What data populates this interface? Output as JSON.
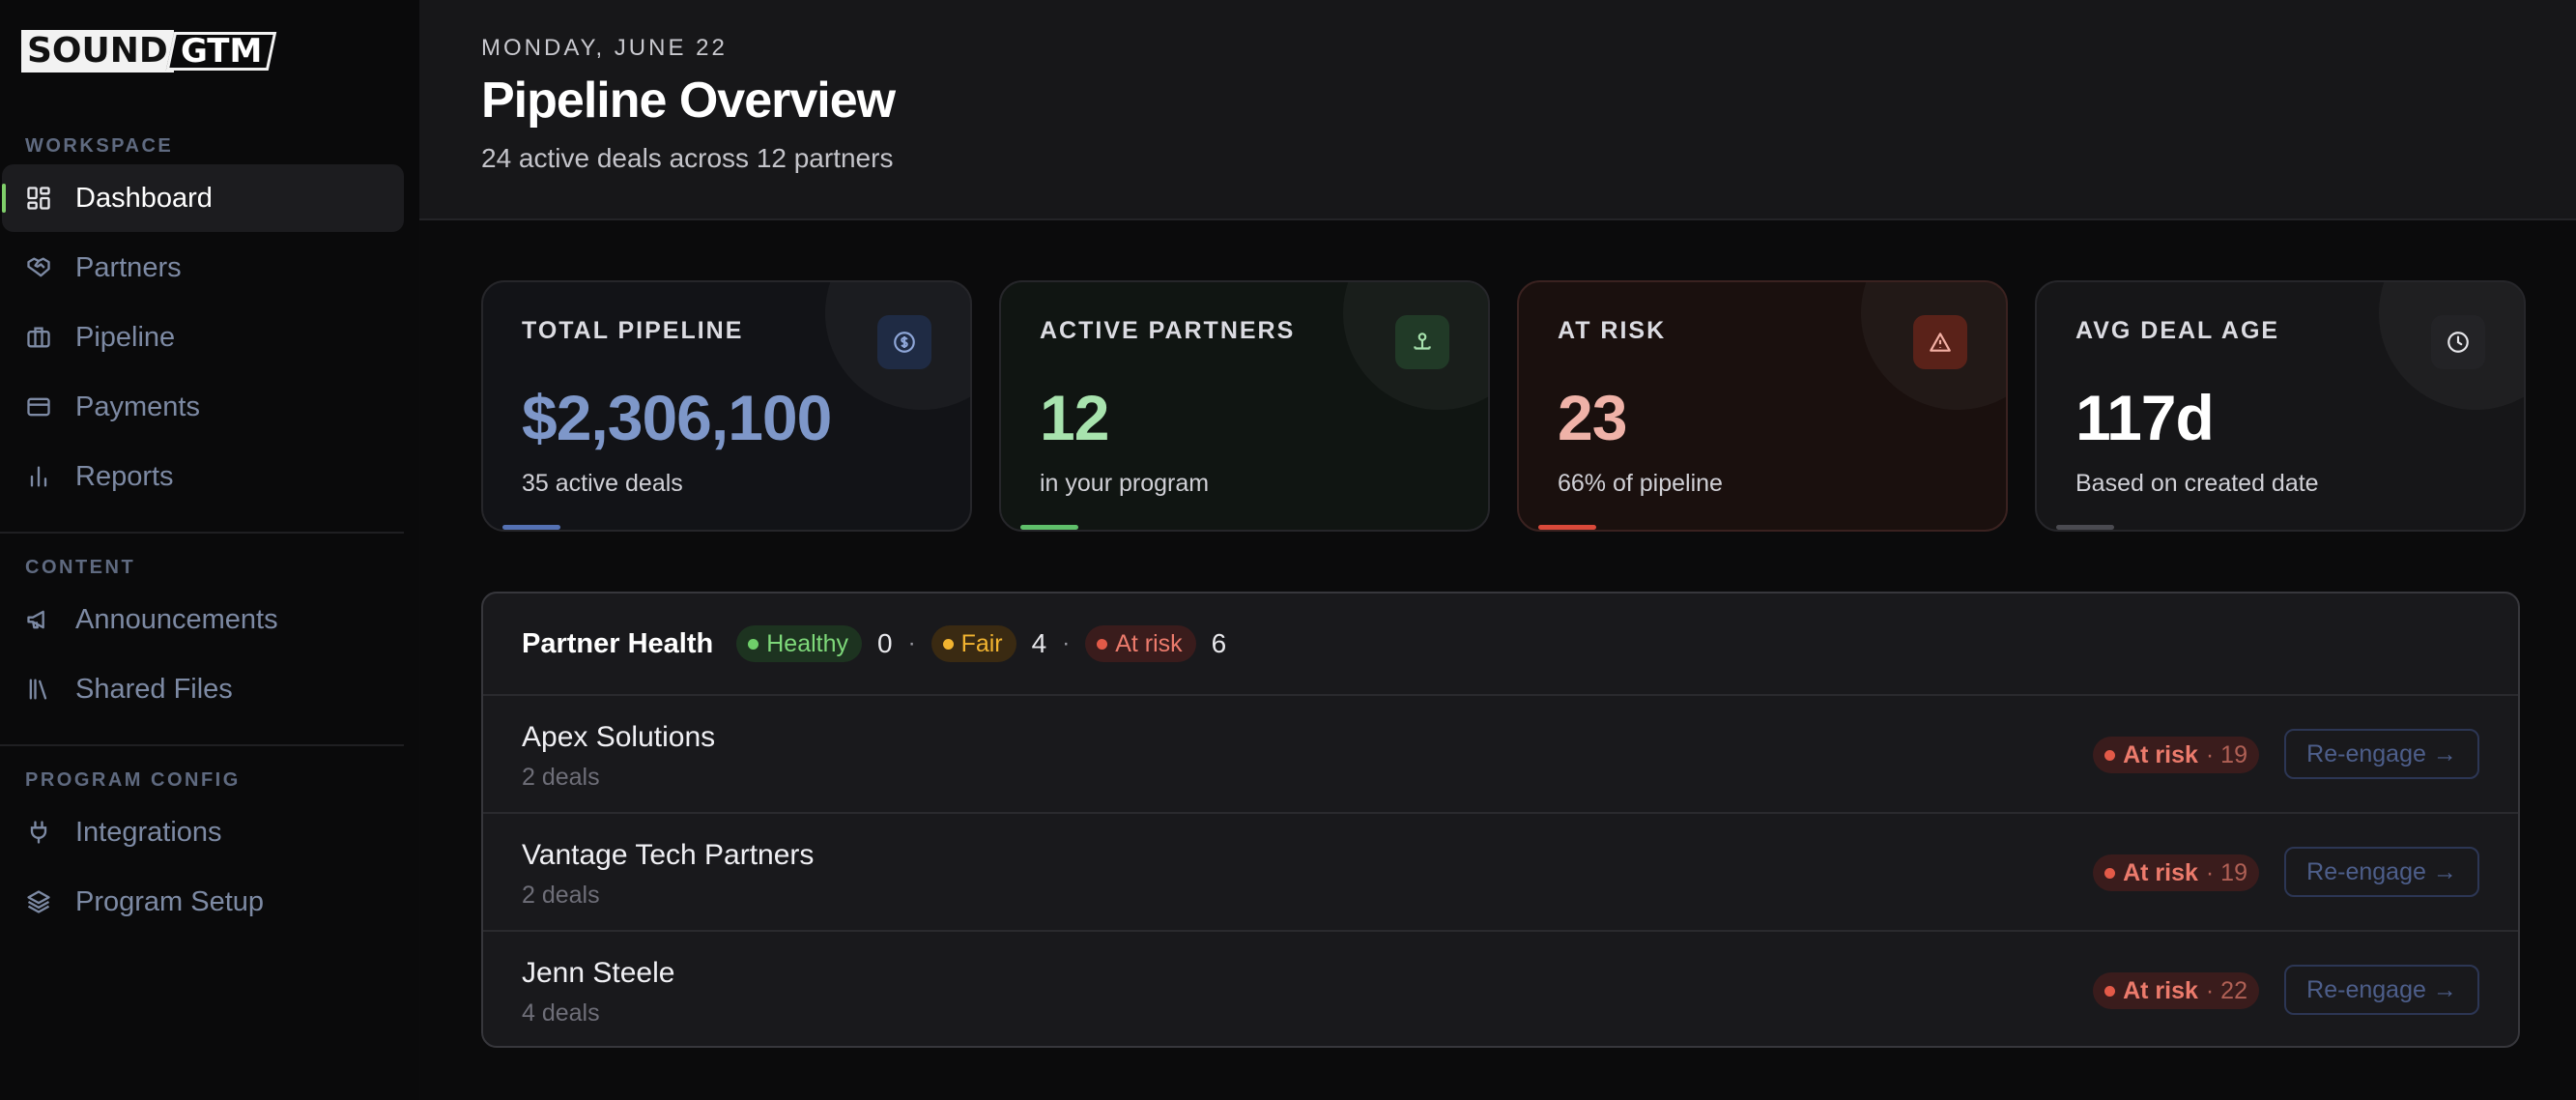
{
  "brand": {
    "word1": "SOUND",
    "word2": "GTM"
  },
  "sidebar": {
    "sections": [
      {
        "label": "WORKSPACE"
      },
      {
        "label": "CONTENT"
      },
      {
        "label": "PROGRAM CONFIG"
      }
    ],
    "items": [
      {
        "label": "Dashboard",
        "icon": "dashboard-icon",
        "active": true
      },
      {
        "label": "Partners",
        "icon": "handshake-icon"
      },
      {
        "label": "Pipeline",
        "icon": "briefcase-icon"
      },
      {
        "label": "Payments",
        "icon": "credit-card-icon"
      },
      {
        "label": "Reports",
        "icon": "bar-chart-icon"
      },
      {
        "label": "Announcements",
        "icon": "megaphone-icon"
      },
      {
        "label": "Shared Files",
        "icon": "library-icon"
      },
      {
        "label": "Integrations",
        "icon": "plug-icon"
      },
      {
        "label": "Program Setup",
        "icon": "layers-icon"
      }
    ]
  },
  "header": {
    "date": "MONDAY, JUNE 22",
    "title": "Pipeline Overview",
    "subtitle": "24 active deals across 12 partners"
  },
  "kpis": [
    {
      "label": "TOTAL PIPELINE",
      "value": "$2,306,100",
      "sub": "35 active deals",
      "icon": "dollar-icon",
      "color": "#7e97c9",
      "bar": "#5471b3"
    },
    {
      "label": "ACTIVE PARTNERS",
      "value": "12",
      "sub": "in your program",
      "icon": "network-icon",
      "color": "#a8e3ae",
      "bar": "#5fbf6a"
    },
    {
      "label": "AT RISK",
      "value": "23",
      "sub": "66% of pipeline",
      "icon": "warning-icon",
      "color": "#efb2a8",
      "bar": "#d9493a"
    },
    {
      "label": "AVG DEAL AGE",
      "value": "117d",
      "sub": "Based on created date",
      "icon": "clock-icon",
      "color": "#ffffff",
      "bar": "#4a4a50"
    }
  ],
  "health": {
    "title": "Partner Health",
    "healthy": {
      "label": "Healthy",
      "count": "0",
      "color": "#6fcf6a"
    },
    "fair": {
      "label": "Fair",
      "count": "4",
      "color": "#f2b430"
    },
    "at_risk": {
      "label": "At risk",
      "count": "6",
      "color": "#e35a48"
    },
    "separator": "·",
    "rows": [
      {
        "name": "Apex Solutions",
        "deals": "2 deals",
        "status": "At risk",
        "score": "· 19",
        "action": "Re-engage →"
      },
      {
        "name": "Vantage Tech Partners",
        "deals": "2 deals",
        "status": "At risk",
        "score": "· 19",
        "action": "Re-engage →"
      },
      {
        "name": "Jenn Steele",
        "deals": "4 deals",
        "status": "At risk",
        "score": "· 22",
        "action": "Re-engage →"
      }
    ]
  }
}
